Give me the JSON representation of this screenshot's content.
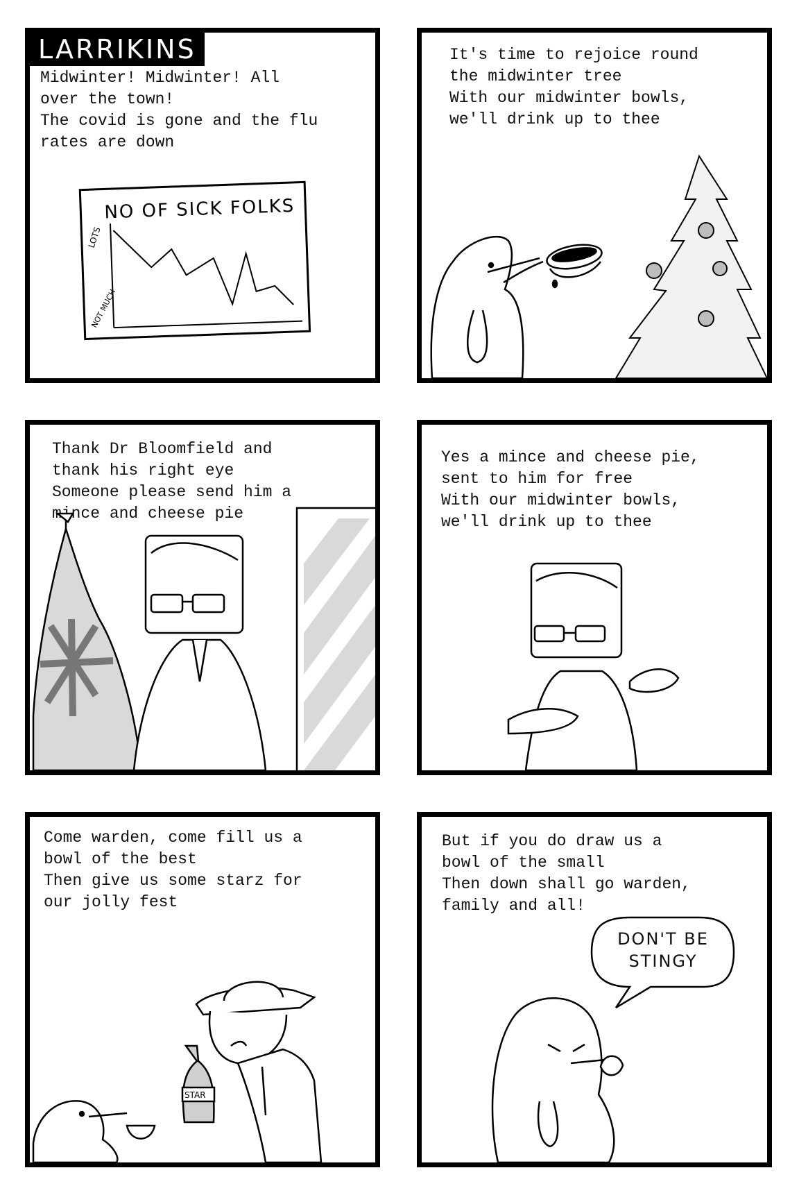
{
  "comic": {
    "logo": "LARRIKINS",
    "panels": [
      {
        "caption": "Midwinter! Midwinter! All\nover the town!\nThe covid is gone and the flu\nrates are down",
        "chart_sign": {
          "title": "NO OF SICK FOLKS",
          "y_high_label": "LOTS",
          "y_low_label": "NOT MUCH"
        }
      },
      {
        "caption": "It's time to rejoice round\nthe midwinter tree\nWith our midwinter bowls,\nwe'll drink up to thee"
      },
      {
        "caption": "Thank Dr Bloomfield and\nthank his right eye\nSomeone please send him a\nmince and cheese pie"
      },
      {
        "caption": "Yes a mince and cheese pie,\nsent to him for free\nWith our midwinter bowls,\nwe'll drink up to thee"
      },
      {
        "caption": "Come warden, come fill us a\nbowl of the best\nThen give us some starz for\nour jolly fest",
        "bottle_label": "STAR"
      },
      {
        "caption": "But if you do draw us a\nbowl of the small\nThen down shall go warden,\nfamily and all!",
        "speech": "DON'T BE\nSTINGY"
      }
    ]
  },
  "colors": {
    "ink": "#000000",
    "paper": "#ffffff",
    "grey": "#bdbdbd"
  }
}
